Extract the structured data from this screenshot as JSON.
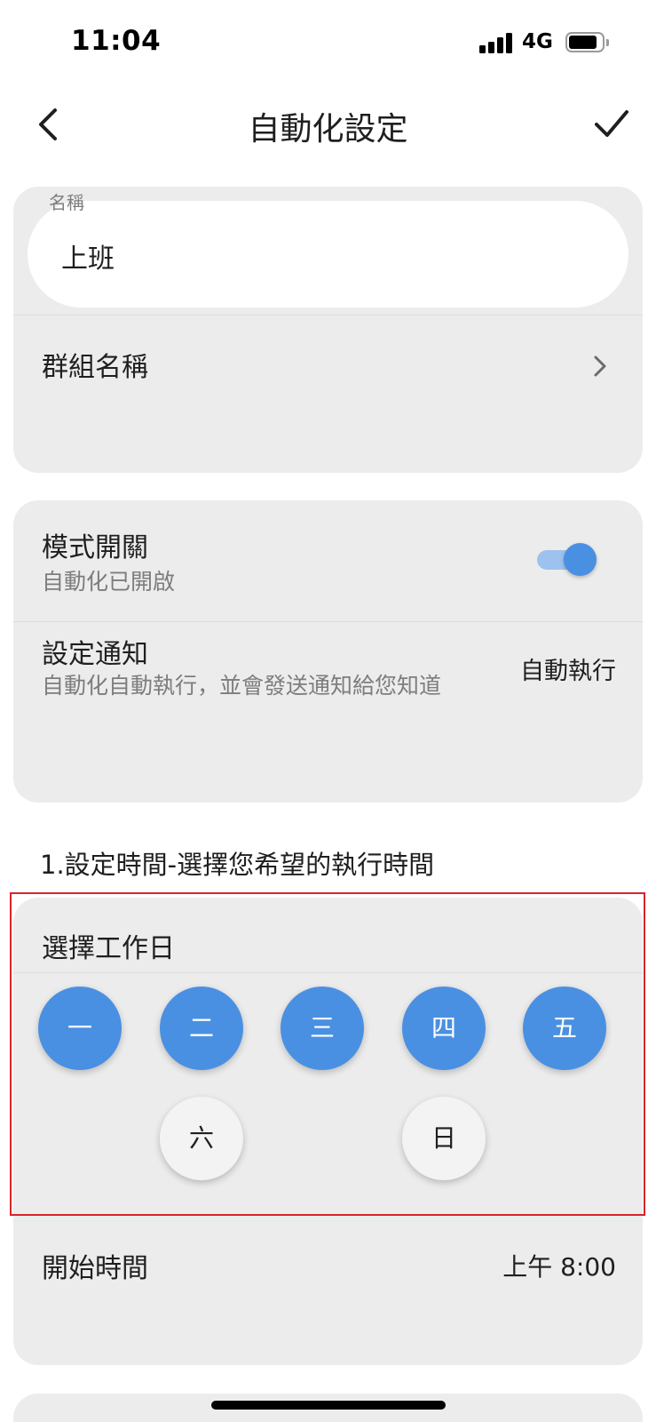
{
  "status_bar": {
    "time": "11:04",
    "network": "4G",
    "signal_icon": "cellular-signal-icon",
    "battery_icon": "battery-icon",
    "battery_level": 0.8
  },
  "nav": {
    "back_icon": "chevron-left-icon",
    "title": "自動化設定",
    "confirm_icon": "checkmark-icon"
  },
  "name_section": {
    "label": "名稱",
    "value": "上班",
    "group_label": "群組名稱",
    "group_icon": "chevron-right-icon"
  },
  "mode_section": {
    "switch_title": "模式開關",
    "switch_subtitle": "自動化已開啟",
    "switch_on": true,
    "notify_title": "設定通知",
    "notify_subtitle": "自動化自動執行，並會發送通知給您知道",
    "notify_value": "自動執行"
  },
  "time_section": {
    "heading": "1.設定時間-選擇您希望的執行時間",
    "weekday_title": "選擇工作日",
    "days": [
      {
        "label": "一",
        "selected": true
      },
      {
        "label": "二",
        "selected": true
      },
      {
        "label": "三",
        "selected": true
      },
      {
        "label": "四",
        "selected": true
      },
      {
        "label": "五",
        "selected": true
      },
      {
        "label": "六",
        "selected": false
      },
      {
        "label": "日",
        "selected": false
      }
    ],
    "start_label": "開始時間",
    "start_value": "上午 8:00"
  },
  "colors": {
    "accent": "#4a90e2",
    "card_bg": "#ececec",
    "highlight": "#d8232a"
  }
}
